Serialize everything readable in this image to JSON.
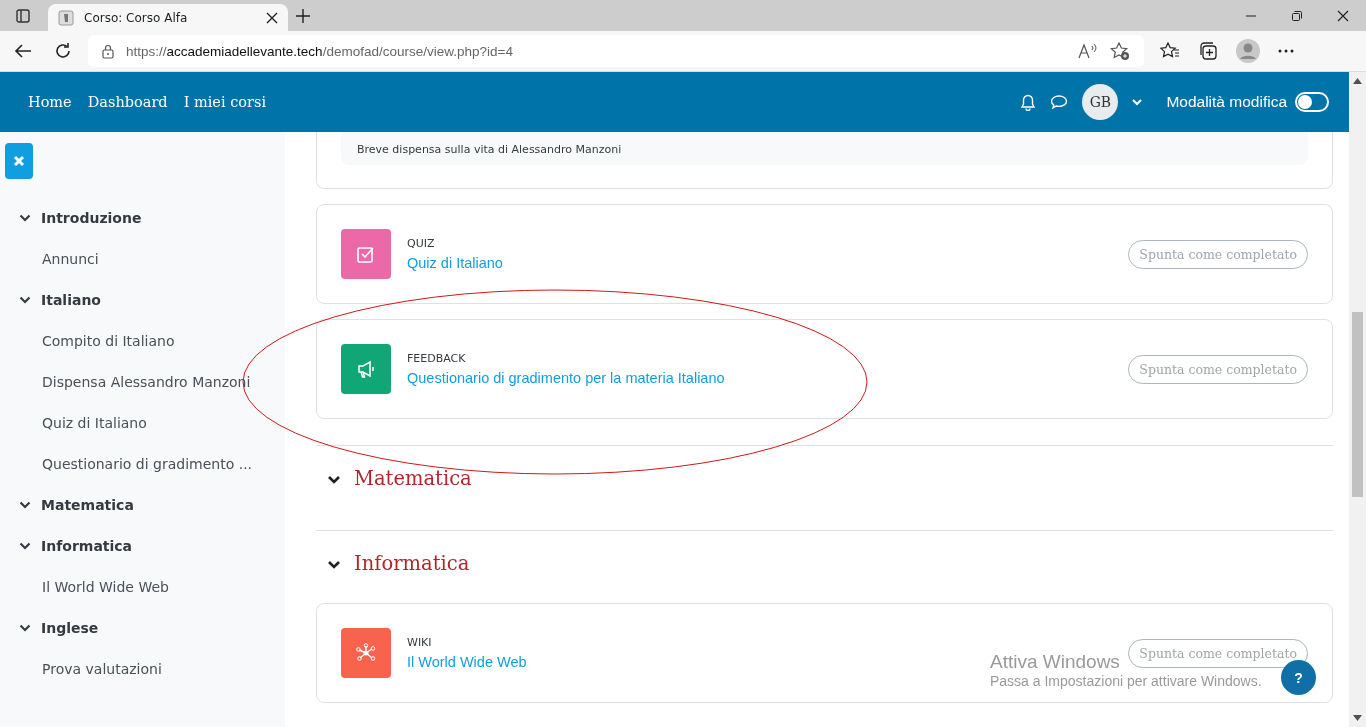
{
  "browser": {
    "tab_title": "Corso: Corso Alfa",
    "url_scheme": "https://",
    "url_host": "accademiadellevante.tech",
    "url_path": "/demofad/course/view.php?id=4"
  },
  "navbar": {
    "links": [
      "Home",
      "Dashboard",
      "I miei corsi"
    ],
    "user_initials": "GB",
    "edit_mode_label": "Modalità modifica",
    "edit_mode_on": false
  },
  "sidebar": {
    "sections": [
      {
        "title": "Introduzione",
        "expanded": true,
        "children": [
          "Annunci"
        ]
      },
      {
        "title": "Italiano",
        "expanded": true,
        "children": [
          "Compito di Italiano",
          "Dispensa Alessandro Manzoni",
          "Quiz di Italiano",
          "Questionario di gradimento ..."
        ]
      },
      {
        "title": "Matematica",
        "expanded": true
      },
      {
        "title": "Informatica",
        "expanded": true,
        "children": [
          "Il World Wide Web"
        ]
      },
      {
        "title": "Inglese",
        "expanded": true,
        "children": [
          "Prova valutazioni"
        ]
      }
    ]
  },
  "content": [
    {
      "kind": "description",
      "text": "Breve dispensa sulla vita di Alessandro Manzoni"
    },
    {
      "kind": "quiz",
      "type_label": "QUIZ",
      "name": "Quiz di Italiano",
      "completion_button": "Spunta come completato"
    },
    {
      "kind": "feedback",
      "type_label": "FEEDBACK",
      "name": "Questionario di gradimento per la materia Italiano",
      "completion_button": "Spunta come completato"
    },
    {
      "kind": "section",
      "title": "Matematica",
      "expanded": true
    },
    {
      "kind": "section",
      "title": "Informatica",
      "expanded": true
    },
    {
      "kind": "wiki",
      "type_label": "WIKI",
      "name": "Il World Wide Web",
      "completion_button": "Spunta come completato"
    }
  ],
  "help_button": "?",
  "os_notice": {
    "title": "Attiva Windows",
    "text": "Passa a Impostazioni per attivare Windows."
  }
}
